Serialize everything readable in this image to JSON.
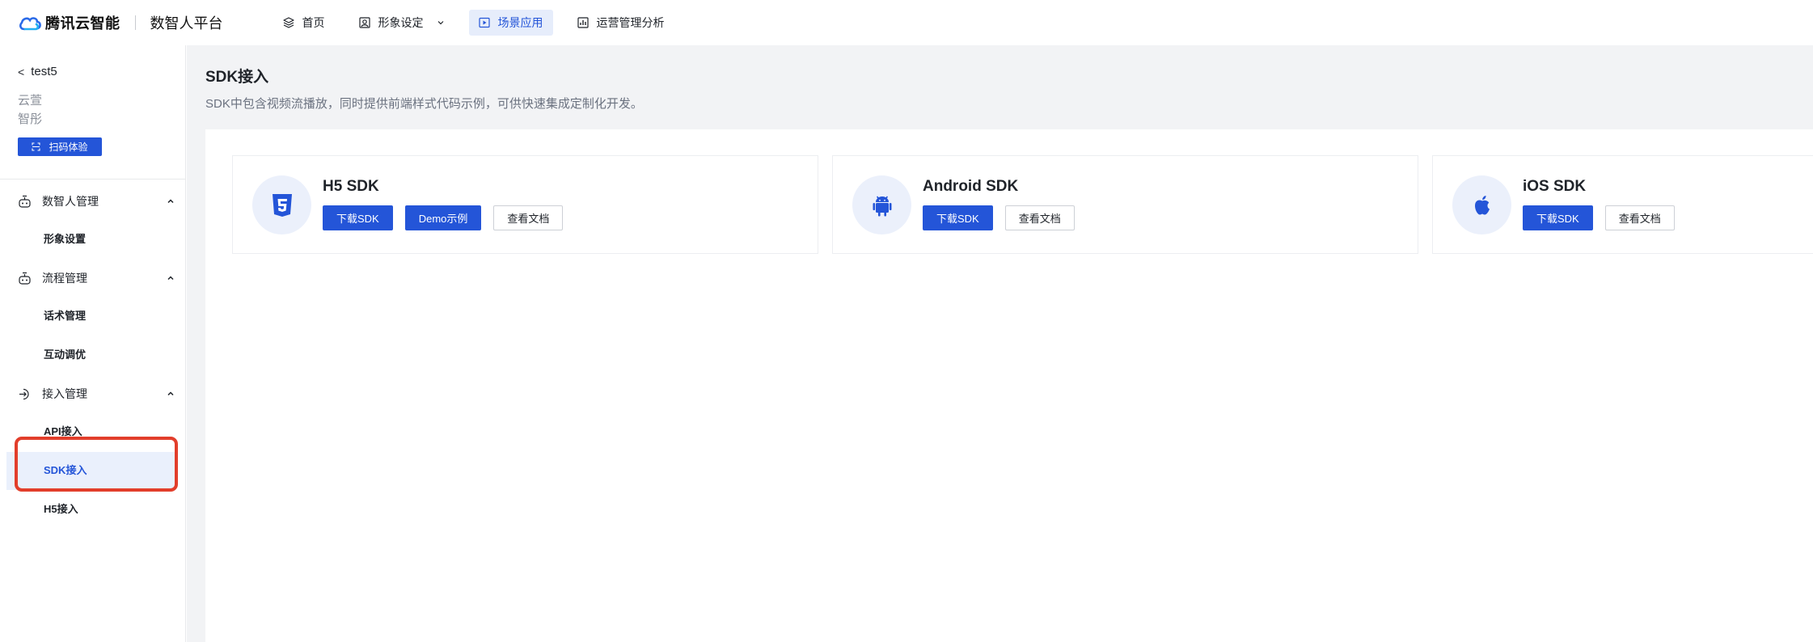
{
  "brand": {
    "logo_text": "腾讯云智能",
    "platform": "数智人平台",
    "accent": "#2455d8"
  },
  "nav": {
    "items": [
      {
        "label": "首页",
        "icon": "layers-icon"
      },
      {
        "label": "形象设定",
        "icon": "portrait-icon"
      },
      {
        "label": "场景应用",
        "icon": "play-square-icon"
      },
      {
        "label": "运营管理分析",
        "icon": "bar-chart-icon"
      }
    ]
  },
  "sidebar": {
    "back_label": "test5",
    "app_sub1": "云萱",
    "app_sub2": "智彤",
    "scan_button": "扫码体验",
    "groups": [
      {
        "label": "数智人管理",
        "icon": "robot-icon",
        "items": [
          "形象设置"
        ]
      },
      {
        "label": "流程管理",
        "icon": "robot-icon",
        "items": [
          "话术管理",
          "互动调优"
        ]
      },
      {
        "label": "接入管理",
        "icon": "login-icon",
        "items": [
          "API接入",
          "SDK接入",
          "H5接入"
        ]
      }
    ],
    "active_item": "SDK接入"
  },
  "main": {
    "title": "SDK接入",
    "description": "SDK中包含视频流播放，同时提供前端样式代码示例，可供快速集成定制化开发。",
    "cards": [
      {
        "title": "H5 SDK",
        "icon": "html5-icon",
        "buttons": [
          "下载SDK",
          "Demo示例",
          "查看文档"
        ]
      },
      {
        "title": "Android SDK",
        "icon": "android-icon",
        "buttons": [
          "下载SDK",
          "查看文档"
        ]
      },
      {
        "title": "iOS SDK",
        "icon": "apple-icon",
        "buttons": [
          "下载SDK",
          "查看文档"
        ]
      }
    ]
  }
}
